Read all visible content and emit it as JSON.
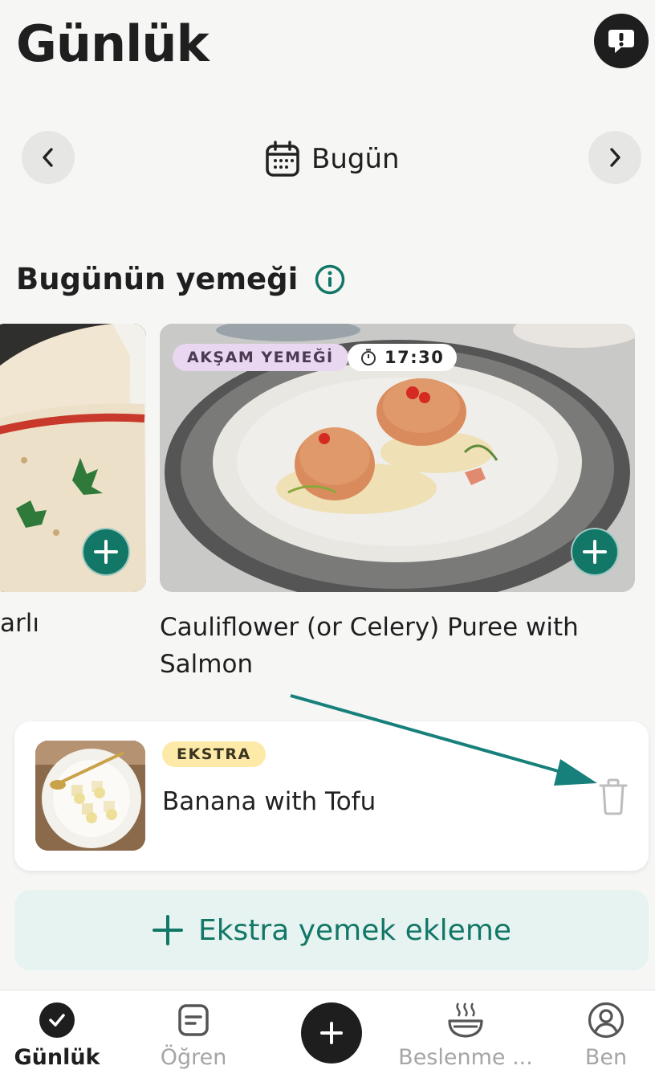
{
  "header": {
    "title": "Günlük",
    "feedback_icon": "feedback-exclamation-icon"
  },
  "date_nav": {
    "label": "Bugün",
    "prev_icon": "chevron-left-icon",
    "next_icon": "chevron-right-icon",
    "calendar_icon": "calendar-icon"
  },
  "meals_section": {
    "title": "Bugünün yemeği",
    "info_icon": "info-icon",
    "cards": [
      {
        "caption": "arlı"
      },
      {
        "category": "AKŞAM YEMEĞİ",
        "time": "17:30",
        "caption": "Cauliflower (or Celery) Puree with Salmon"
      }
    ]
  },
  "extra_item": {
    "badge": "EKSTRA",
    "name": "Banana with Tofu",
    "delete_icon": "trash-icon"
  },
  "add_extra": {
    "label": "Ekstra yemek ekleme"
  },
  "bottom_nav": {
    "tabs": [
      {
        "label": "Günlük",
        "icon": "check-circle-icon",
        "active": true
      },
      {
        "label": "Öğren",
        "icon": "learn-card-icon",
        "active": false
      },
      {
        "label": "",
        "icon": "plus-icon",
        "active": false
      },
      {
        "label": "Beslenme ...",
        "icon": "bowl-icon",
        "active": false
      },
      {
        "label": "Ben",
        "icon": "profile-icon",
        "active": false
      }
    ]
  },
  "colors": {
    "accent": "#127766",
    "arrow": "#17807a",
    "chip_dinner": "#e9d7f2",
    "chip_extra": "#fdeaa8",
    "add_extra_bg": "#e6f3f1"
  }
}
